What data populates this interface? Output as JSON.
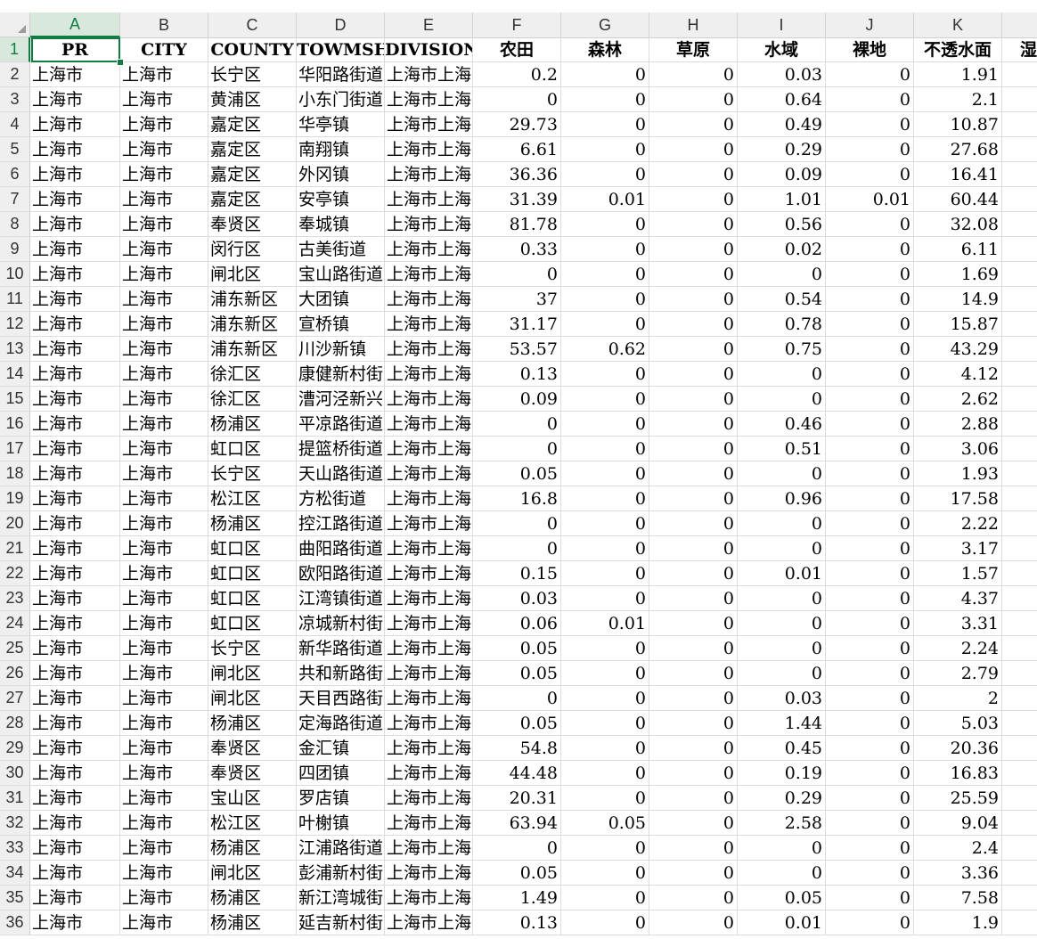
{
  "sheet": {
    "column_letters": [
      "A",
      "B",
      "C",
      "D",
      "E",
      "F",
      "G",
      "H",
      "I",
      "J",
      "K",
      ""
    ],
    "header_row": [
      "PR",
      "CITY",
      "COUNTY",
      "TOWMSHIP",
      "DIVISION",
      "农田",
      "森林",
      "草原",
      "水域",
      "裸地",
      "不透水面",
      "湿"
    ],
    "active_cell": "A1",
    "rows": [
      [
        "上海市",
        "上海市",
        "长宁区",
        "华阳路街道",
        "上海市上海市",
        "0.2",
        "0",
        "0",
        "0.03",
        "0",
        "1.91"
      ],
      [
        "上海市",
        "上海市",
        "黄浦区",
        "小东门街道",
        "上海市上海市",
        "0",
        "0",
        "0",
        "0.64",
        "0",
        "2.1"
      ],
      [
        "上海市",
        "上海市",
        "嘉定区",
        "华亭镇",
        "上海市上海市",
        "29.73",
        "0",
        "0",
        "0.49",
        "0",
        "10.87"
      ],
      [
        "上海市",
        "上海市",
        "嘉定区",
        "南翔镇",
        "上海市上海市",
        "6.61",
        "0",
        "0",
        "0.29",
        "0",
        "27.68"
      ],
      [
        "上海市",
        "上海市",
        "嘉定区",
        "外冈镇",
        "上海市上海市",
        "36.36",
        "0",
        "0",
        "0.09",
        "0",
        "16.41"
      ],
      [
        "上海市",
        "上海市",
        "嘉定区",
        "安亭镇",
        "上海市上海市",
        "31.39",
        "0.01",
        "0",
        "1.01",
        "0.01",
        "60.44"
      ],
      [
        "上海市",
        "上海市",
        "奉贤区",
        "奉城镇",
        "上海市上海市",
        "81.78",
        "0",
        "0",
        "0.56",
        "0",
        "32.08"
      ],
      [
        "上海市",
        "上海市",
        "闵行区",
        "古美街道",
        "上海市上海市",
        "0.33",
        "0",
        "0",
        "0.02",
        "0",
        "6.11"
      ],
      [
        "上海市",
        "上海市",
        "闸北区",
        "宝山路街道",
        "上海市上海市",
        "0",
        "0",
        "0",
        "0",
        "0",
        "1.69"
      ],
      [
        "上海市",
        "上海市",
        "浦东新区",
        "大团镇",
        "上海市上海市",
        "37",
        "0",
        "0",
        "0.54",
        "0",
        "14.9"
      ],
      [
        "上海市",
        "上海市",
        "浦东新区",
        "宣桥镇",
        "上海市上海市",
        "31.17",
        "0",
        "0",
        "0.78",
        "0",
        "15.87"
      ],
      [
        "上海市",
        "上海市",
        "浦东新区",
        "川沙新镇",
        "上海市上海市",
        "53.57",
        "0.62",
        "0",
        "0.75",
        "0",
        "43.29"
      ],
      [
        "上海市",
        "上海市",
        "徐汇区",
        "康健新村街道",
        "上海市上海市",
        "0.13",
        "0",
        "0",
        "0",
        "0",
        "4.12"
      ],
      [
        "上海市",
        "上海市",
        "徐汇区",
        "漕河泾新兴",
        "上海市上海市",
        "0.09",
        "0",
        "0",
        "0",
        "0",
        "2.62"
      ],
      [
        "上海市",
        "上海市",
        "杨浦区",
        "平凉路街道",
        "上海市上海市",
        "0",
        "0",
        "0",
        "0.46",
        "0",
        "2.88"
      ],
      [
        "上海市",
        "上海市",
        "虹口区",
        "提篮桥街道",
        "上海市上海市",
        "0",
        "0",
        "0",
        "0.51",
        "0",
        "3.06"
      ],
      [
        "上海市",
        "上海市",
        "长宁区",
        "天山路街道",
        "上海市上海市",
        "0.05",
        "0",
        "0",
        "0",
        "0",
        "1.93"
      ],
      [
        "上海市",
        "上海市",
        "松江区",
        "方松街道",
        "上海市上海市",
        "16.8",
        "0",
        "0",
        "0.96",
        "0",
        "17.58"
      ],
      [
        "上海市",
        "上海市",
        "杨浦区",
        "控江路街道",
        "上海市上海市",
        "0",
        "0",
        "0",
        "0",
        "0",
        "2.22"
      ],
      [
        "上海市",
        "上海市",
        "虹口区",
        "曲阳路街道",
        "上海市上海市",
        "0",
        "0",
        "0",
        "0",
        "0",
        "3.17"
      ],
      [
        "上海市",
        "上海市",
        "虹口区",
        "欧阳路街道",
        "上海市上海市",
        "0.15",
        "0",
        "0",
        "0.01",
        "0",
        "1.57"
      ],
      [
        "上海市",
        "上海市",
        "虹口区",
        "江湾镇街道",
        "上海市上海市",
        "0.03",
        "0",
        "0",
        "0",
        "0",
        "4.37"
      ],
      [
        "上海市",
        "上海市",
        "虹口区",
        "凉城新村街道",
        "上海市上海市",
        "0.06",
        "0.01",
        "0",
        "0",
        "0",
        "3.31"
      ],
      [
        "上海市",
        "上海市",
        "长宁区",
        "新华路街道",
        "上海市上海市",
        "0.05",
        "0",
        "0",
        "0",
        "0",
        "2.24"
      ],
      [
        "上海市",
        "上海市",
        "闸北区",
        "共和新路街道",
        "上海市上海市",
        "0.05",
        "0",
        "0",
        "0",
        "0",
        "2.79"
      ],
      [
        "上海市",
        "上海市",
        "闸北区",
        "天目西路街道",
        "上海市上海市",
        "0",
        "0",
        "0",
        "0.03",
        "0",
        "2"
      ],
      [
        "上海市",
        "上海市",
        "杨浦区",
        "定海路街道",
        "上海市上海市",
        "0.05",
        "0",
        "0",
        "1.44",
        "0",
        "5.03"
      ],
      [
        "上海市",
        "上海市",
        "奉贤区",
        "金汇镇",
        "上海市上海市",
        "54.8",
        "0",
        "0",
        "0.45",
        "0",
        "20.36"
      ],
      [
        "上海市",
        "上海市",
        "奉贤区",
        "四团镇",
        "上海市上海市",
        "44.48",
        "0",
        "0",
        "0.19",
        "0",
        "16.83"
      ],
      [
        "上海市",
        "上海市",
        "宝山区",
        "罗店镇",
        "上海市上海市",
        "20.31",
        "0",
        "0",
        "0.29",
        "0",
        "25.59"
      ],
      [
        "上海市",
        "上海市",
        "松江区",
        "叶榭镇",
        "上海市上海市",
        "63.94",
        "0.05",
        "0",
        "2.58",
        "0",
        "9.04"
      ],
      [
        "上海市",
        "上海市",
        "杨浦区",
        "江浦路街道",
        "上海市上海市",
        "0",
        "0",
        "0",
        "0",
        "0",
        "2.4"
      ],
      [
        "上海市",
        "上海市",
        "闸北区",
        "彭浦新村街道",
        "上海市上海市",
        "0.05",
        "0",
        "0",
        "0",
        "0",
        "3.36"
      ],
      [
        "上海市",
        "上海市",
        "杨浦区",
        "新江湾城街道",
        "上海市上海市",
        "1.49",
        "0",
        "0",
        "0.05",
        "0",
        "7.58"
      ],
      [
        "上海市",
        "上海市",
        "杨浦区",
        "延吉新村街道",
        "上海市上海市",
        "0.13",
        "0",
        "0",
        "0.01",
        "0",
        "1.9"
      ]
    ]
  }
}
